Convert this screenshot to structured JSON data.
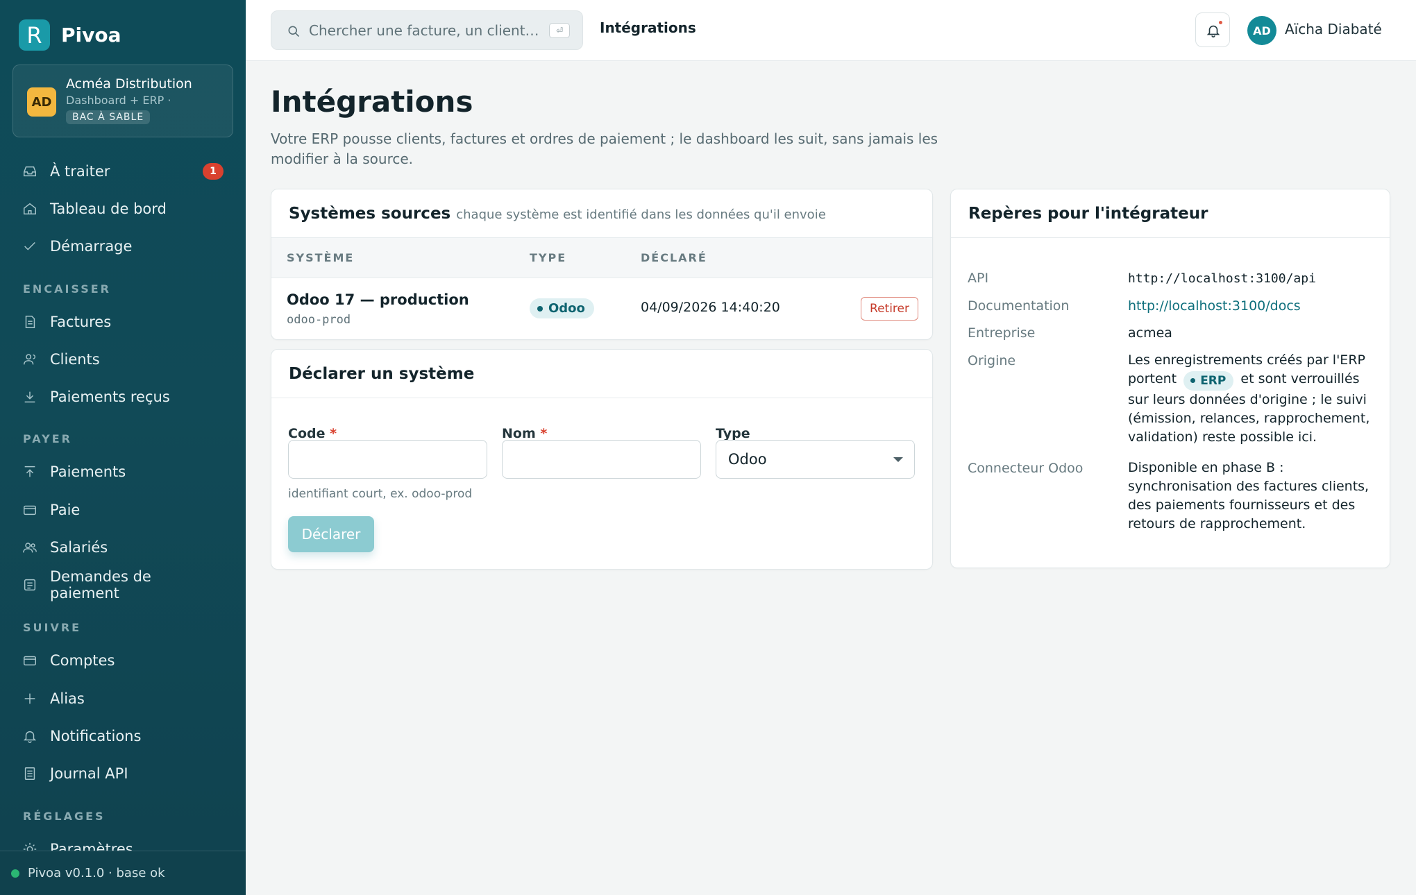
{
  "app": {
    "name": "Pivoa",
    "logo_letter": "R"
  },
  "org": {
    "initials": "AD",
    "name": "Acméa Distribution",
    "subtitle": "Dashboard + ERP ·",
    "env_badge": "BAC À SABLE"
  },
  "sidebar": {
    "items": [
      {
        "label": "À traiter",
        "icon": "inbox-icon",
        "badge": "1"
      },
      {
        "label": "Tableau de bord",
        "icon": "home-icon"
      },
      {
        "label": "Démarrage",
        "icon": "check-icon"
      },
      {
        "section": "ENCAISSER"
      },
      {
        "label": "Factures",
        "icon": "document-icon"
      },
      {
        "label": "Clients",
        "icon": "users-icon"
      },
      {
        "label": "Paiements reçus",
        "icon": "download-icon"
      },
      {
        "section": "PAYER"
      },
      {
        "label": "Paiements",
        "icon": "upload-icon"
      },
      {
        "label": "Paie",
        "icon": "card-icon"
      },
      {
        "label": "Salariés",
        "icon": "people-icon"
      },
      {
        "label": "Demandes de paiement",
        "icon": "list-icon"
      },
      {
        "section": "SUIVRE"
      },
      {
        "label": "Comptes",
        "icon": "card-icon"
      },
      {
        "label": "Alias",
        "icon": "plus-icon"
      },
      {
        "label": "Notifications",
        "icon": "bell-icon"
      },
      {
        "label": "Journal API",
        "icon": "log-icon"
      },
      {
        "section": "RÉGLAGES"
      },
      {
        "label": "Paramètres",
        "icon": "sun-icon"
      }
    ],
    "footer": "Pivoa v0.1.0 · base ok"
  },
  "topbar": {
    "search_placeholder": "Chercher une facture, un client…",
    "search_key": "⏎",
    "breadcrumb": "Intégrations",
    "user_initials": "AD",
    "user_name": "Aïcha Diabaté"
  },
  "page": {
    "title": "Intégrations",
    "description": "Votre ERP pousse clients, factures et ordres de paiement ; le dashboard les suit, sans jamais les modifier à la source."
  },
  "sources": {
    "title": "Systèmes sources",
    "hint": "chaque système est identifié dans les données qu'il envoie",
    "columns": [
      "SYSTÈME",
      "TYPE",
      "DÉCLARÉ"
    ],
    "rows": [
      {
        "name": "Odoo 17 — production",
        "code": "odoo-prod",
        "type": "Odoo",
        "declared": "04/09/2026 14:40:20",
        "action": "Retirer"
      }
    ]
  },
  "declare": {
    "title": "Déclarer un système",
    "code_label": "Code",
    "name_label": "Nom",
    "type_label": "Type",
    "required_mark": "*",
    "code_value": "",
    "name_value": "",
    "type_value": "Odoo",
    "code_help": "identifiant court, ex. odoo-prod",
    "submit_label": "Déclarer"
  },
  "integrator": {
    "title": "Repères pour l'intégrateur",
    "rows": [
      {
        "label": "API",
        "value": "http://localhost:3100/api"
      },
      {
        "label": "Documentation",
        "value": "http://localhost:3100/docs"
      },
      {
        "label": "Entreprise",
        "value": "acmea"
      },
      {
        "label": "Origine",
        "value_before": "Les enregistrements créés par l'ERP portent",
        "pill": "ERP",
        "value_after": "et sont verrouillés sur leurs données d'origine ; le suivi (émission, relances, rapprochement, validation) reste possible ici."
      },
      {
        "label": "Connecteur Odoo",
        "value": "Disponible en phase B : synchronisation des factures clients, des paiements fournisseurs et des retours de rapprochement."
      }
    ]
  },
  "colors": {
    "sidebar_bg": "#0e4b58",
    "accent": "#138a97",
    "danger": "#d9412f",
    "org_avatar": "#f3b73f"
  }
}
